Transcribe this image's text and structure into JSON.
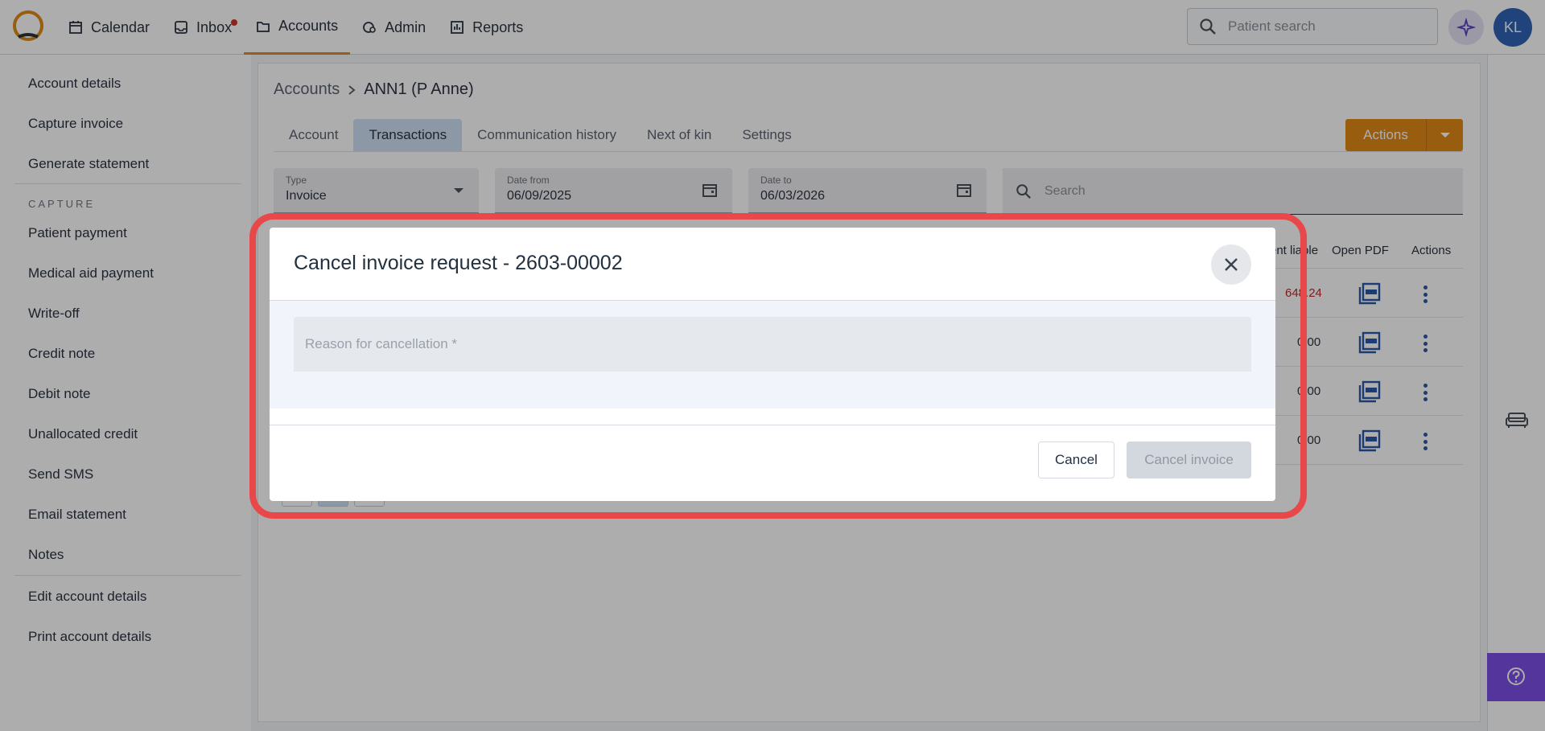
{
  "topbar": {
    "nav": [
      {
        "label": "Calendar",
        "icon": "calendar-icon"
      },
      {
        "label": "Inbox",
        "icon": "inbox-icon"
      },
      {
        "label": "Accounts",
        "icon": "folder-icon"
      },
      {
        "label": "Admin",
        "icon": "admin-icon"
      },
      {
        "label": "Reports",
        "icon": "reports-icon"
      }
    ],
    "search_placeholder": "Patient search",
    "avatar_initials": "KL"
  },
  "sidebar": {
    "group1": [
      "Account details",
      "Capture invoice",
      "Generate statement"
    ],
    "section_label": "CAPTURE",
    "group2": [
      "Patient payment",
      "Medical aid payment",
      "Write-off",
      "Credit note",
      "Debit note",
      "Unallocated credit",
      "Send SMS",
      "Email statement",
      "Notes"
    ],
    "group3": [
      "Edit account details",
      "Print account details"
    ]
  },
  "main": {
    "breadcrumb_root": "Accounts",
    "breadcrumb_current": "ANN1 (P Anne)",
    "tabs": [
      "Account",
      "Transactions",
      "Communication history",
      "Next of kin",
      "Settings"
    ],
    "actions_label": "Actions",
    "filters": {
      "type_label": "Type",
      "type_value": "Invoice",
      "date_from_label": "Date from",
      "date_from_value": "06/09/2025",
      "date_to_label": "Date to",
      "date_to_value": "06/03/2026",
      "search_placeholder": "Search"
    },
    "table": {
      "headers": [
        "ent liable",
        "Open PDF",
        "Actions"
      ],
      "rows": [
        {
          "patient_liable": "648.24"
        },
        {
          "patient_liable": "0.00"
        },
        {
          "patient_liable": "0.00"
        },
        {
          "patient_liable": "0.00"
        }
      ]
    }
  },
  "dialog": {
    "title": "Cancel invoice request - 2603-00002",
    "reason_placeholder": "Reason for cancellation *",
    "reason_value": "",
    "cancel_label": "Cancel",
    "confirm_label": "Cancel invoice"
  },
  "colors": {
    "accent": "#e08a16",
    "primary": "#2e63b4",
    "highlight": "#e8484a",
    "help": "#7b4fe6"
  }
}
